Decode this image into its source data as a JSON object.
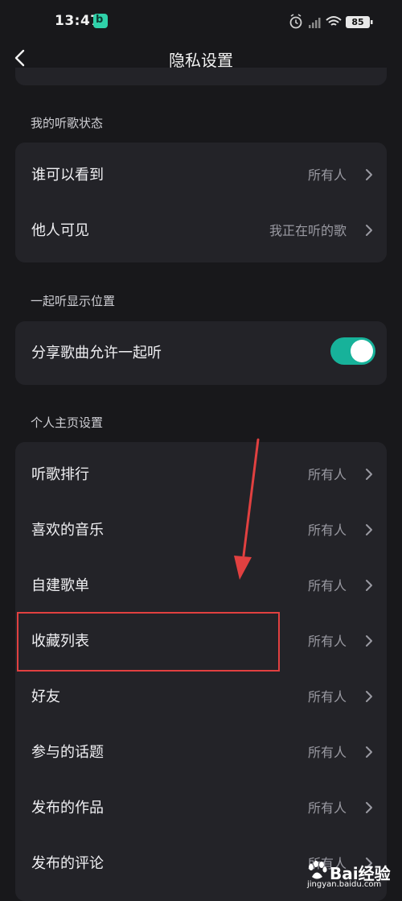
{
  "status_bar": {
    "time": "13:47",
    "battery": "85"
  },
  "header": {
    "title": "隐私设置"
  },
  "sections": [
    {
      "label": "我的听歌状态"
    },
    {
      "label": "一起听显示位置"
    },
    {
      "label": "个人主页设置"
    }
  ],
  "listen_status": [
    {
      "label": "谁可以看到",
      "value": "所有人"
    },
    {
      "label": "他人可见",
      "value": "我正在听的歌"
    }
  ],
  "together": {
    "label": "分享歌曲允许一起听",
    "toggle_on": true
  },
  "profile_items": [
    {
      "label": "听歌排行",
      "value": "所有人"
    },
    {
      "label": "喜欢的音乐",
      "value": "所有人"
    },
    {
      "label": "自建歌单",
      "value": "所有人"
    },
    {
      "label": "收藏列表",
      "value": "所有人"
    },
    {
      "label": "好友",
      "value": "所有人"
    },
    {
      "label": "参与的话题",
      "value": "所有人"
    },
    {
      "label": "发布的作品",
      "value": "所有人"
    },
    {
      "label": "发布的评论",
      "value": "所有人"
    }
  ],
  "watermark": {
    "brand": "Bai经验",
    "url": "jingyan.baidu.com"
  },
  "colors": {
    "background": "#18181b",
    "card": "#232328",
    "toggle_accent": "#17b29a",
    "annotation": "#e14040"
  }
}
